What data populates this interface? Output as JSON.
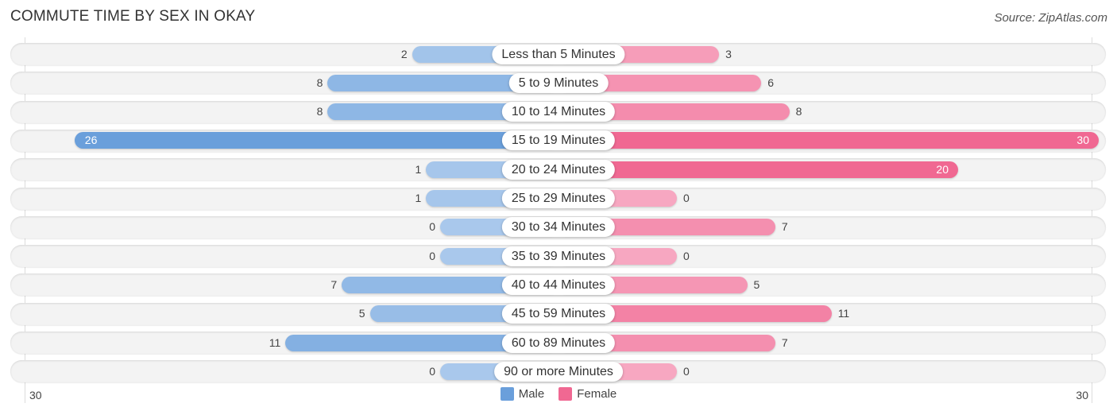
{
  "title": "COMMUTE TIME BY SEX IN OKAY",
  "source": "Source: ZipAtlas.com",
  "colors": {
    "male": "#6a9fdb",
    "male_light": "#a9c8ec",
    "female": "#f06892",
    "female_light": "#f7a7c1"
  },
  "chart_data": {
    "type": "bar",
    "orientation": "horizontal-diverging",
    "title": "COMMUTE TIME BY SEX IN OKAY",
    "categories": [
      "Less than 5 Minutes",
      "5 to 9 Minutes",
      "10 to 14 Minutes",
      "15 to 19 Minutes",
      "20 to 24 Minutes",
      "25 to 29 Minutes",
      "30 to 34 Minutes",
      "35 to 39 Minutes",
      "40 to 44 Minutes",
      "45 to 59 Minutes",
      "60 to 89 Minutes",
      "90 or more Minutes"
    ],
    "series": [
      {
        "name": "Male",
        "values": [
          2,
          8,
          8,
          26,
          1,
          1,
          0,
          0,
          7,
          5,
          11,
          0
        ]
      },
      {
        "name": "Female",
        "values": [
          3,
          6,
          8,
          30,
          20,
          0,
          7,
          0,
          5,
          11,
          7,
          0
        ]
      }
    ],
    "axis": {
      "left_label": "30",
      "right_label": "30",
      "max": 30
    },
    "legend": {
      "position": "bottom-center",
      "entries": [
        "Male",
        "Female"
      ]
    }
  }
}
